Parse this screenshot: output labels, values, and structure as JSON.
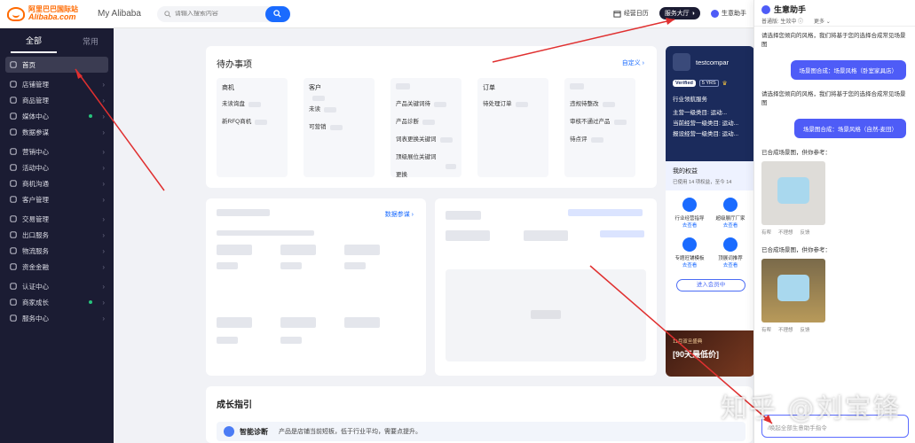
{
  "header": {
    "logo_cn": "阿里巴巴国际站",
    "logo_en": "Alibaba.com",
    "my_alibaba": "My Alibaba",
    "search_placeholder": "请输入搜索内容",
    "items": [
      {
        "label": "经营日历",
        "icon": "calendar-icon"
      },
      {
        "label": "服务大厅",
        "icon": "service-hall-icon"
      },
      {
        "label": "生意助手",
        "icon": "assistant-icon"
      }
    ]
  },
  "sidebar": {
    "tabs": [
      "全部",
      "常用"
    ],
    "items": [
      {
        "label": "首页",
        "icon": "home-icon",
        "active": true
      },
      {
        "label": "店铺管理",
        "icon": "store-icon"
      },
      {
        "label": "商品管理",
        "icon": "product-icon"
      },
      {
        "label": "媒体中心",
        "icon": "media-icon",
        "dot": true
      },
      {
        "label": "数据参谋",
        "icon": "data-icon"
      },
      {
        "label": "营销中心",
        "icon": "marketing-icon"
      },
      {
        "label": "活动中心",
        "icon": "activity-icon"
      },
      {
        "label": "商机沟通",
        "icon": "chat-icon"
      },
      {
        "label": "客户管理",
        "icon": "customer-icon"
      },
      {
        "label": "交易管理",
        "icon": "trade-icon"
      },
      {
        "label": "出口服务",
        "icon": "export-icon"
      },
      {
        "label": "物流服务",
        "icon": "logistics-icon"
      },
      {
        "label": "资金金融",
        "icon": "finance-icon"
      },
      {
        "label": "认证中心",
        "icon": "cert-icon"
      },
      {
        "label": "商家成长",
        "icon": "growth-icon",
        "dot": true
      },
      {
        "label": "服务中心",
        "icon": "service-icon"
      }
    ]
  },
  "todo": {
    "title": "待办事项",
    "custom": "自定义",
    "columns": [
      {
        "head": "商机",
        "rows": [
          "未读询盘",
          "新RFQ商机"
        ]
      },
      {
        "head": "客户",
        "rows": [
          "",
          "未读",
          "可营销"
        ]
      },
      {
        "head": "",
        "rows": [
          "产品关键词待",
          "产品诊断",
          "词表更换关键词",
          "顶级展位关键词更换"
        ]
      },
      {
        "head": "订单",
        "rows": [
          "待处理订单"
        ]
      },
      {
        "head": "",
        "rows": [
          "违规待整改",
          "审核不通过产品",
          "待点评"
        ]
      }
    ]
  },
  "data_card": {
    "link": "数据参谋"
  },
  "profile": {
    "name": "testcompar",
    "verified": "Verified",
    "years": "5 YRS",
    "industry": "行业领航服务",
    "lines": [
      "主营一级类目: 运动...",
      "当前经营一级类目: 运动...",
      "报设经营一级类目: 运动..."
    ],
    "rights_title": "我的权益",
    "rights_used": "已使用 14 项权益，至今 14",
    "perks": [
      {
        "label": "行业经营指导",
        "link": "去查看",
        "icon": "guide-icon"
      },
      {
        "label": "超级展厅厂家",
        "link": "去查看",
        "icon": "showroom-icon"
      },
      {
        "label": "专题旺铺模板",
        "link": "去查看",
        "icon": "template-icon"
      },
      {
        "label": "顶展词推荐",
        "link": "去查看",
        "icon": "keyword-icon"
      }
    ],
    "enter_btn": "进入会员中",
    "banner_line1": "11月双旦盛典",
    "banner_line2": "[90天最低价]"
  },
  "growth": {
    "title": "成长指引",
    "badge": "智能诊断",
    "text": "产品是店铺当前短板，低于行业平均，需要点提升。"
  },
  "assistant": {
    "title": "生意助手",
    "mode": "普通版: 生效中",
    "more": "更多",
    "messages": [
      {
        "side": "left",
        "text": "请选择您倾向的风格，我们将基于您的选择合成常见场景图"
      },
      {
        "side": "right",
        "text": "场景图合成：场景风格（卧室家具店）"
      },
      {
        "side": "left",
        "text": "请选择您倾向的风格，我们将基于您的选择合成常见场景图"
      },
      {
        "side": "right",
        "text": "场景图合成：场景风格（自然-麦田）"
      },
      {
        "side": "left",
        "text": "已合成场景图，供你参考："
      },
      {
        "side": "left",
        "text": "已合成场景图，供你参考："
      }
    ],
    "actions": [
      "有帮",
      "不理想",
      "反馈"
    ],
    "input_placeholder": "/唤起全部生意助手指令"
  },
  "watermark": "知乎 @刘宝锋"
}
